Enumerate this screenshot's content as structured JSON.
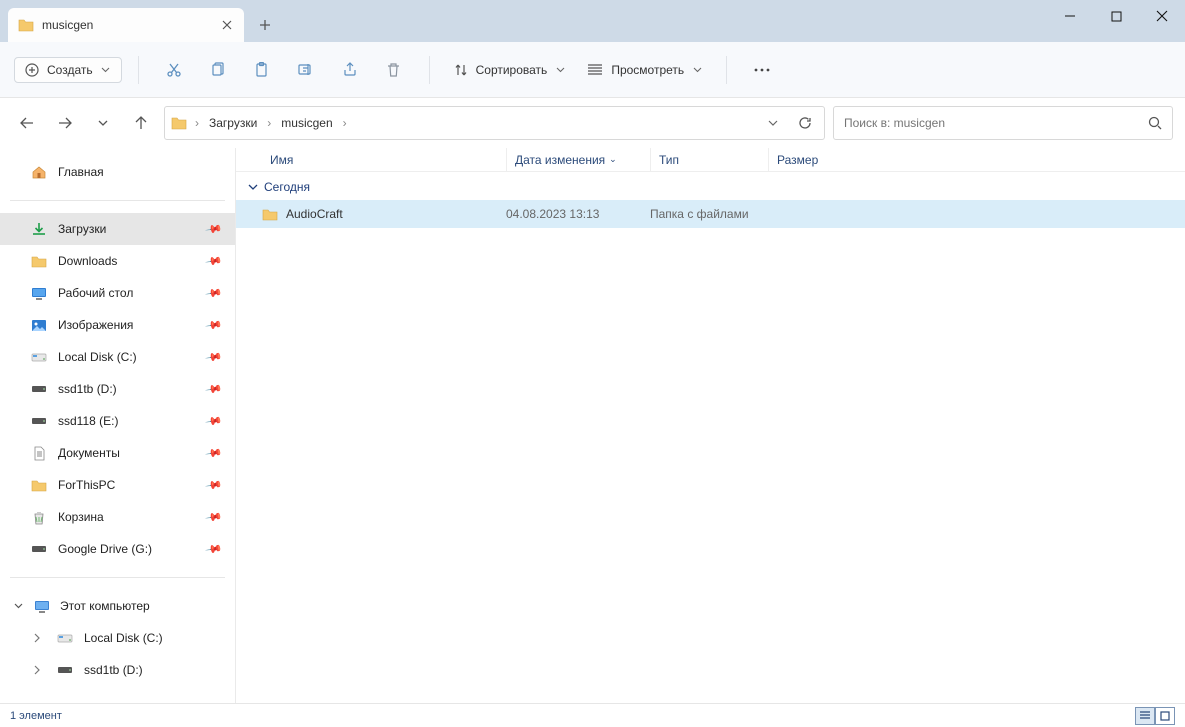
{
  "tab": {
    "title": "musicgen"
  },
  "toolbar": {
    "create": "Создать",
    "sort": "Сортировать",
    "view": "Просмотреть"
  },
  "breadcrumbs": [
    "Загрузки",
    "musicgen"
  ],
  "search": {
    "placeholder": "Поиск в: musicgen"
  },
  "sidebar": {
    "home": "Главная",
    "items": [
      {
        "label": "Загрузки",
        "icon": "download"
      },
      {
        "label": "Downloads",
        "icon": "folder"
      },
      {
        "label": "Рабочий стол",
        "icon": "desktop"
      },
      {
        "label": "Изображения",
        "icon": "pictures"
      },
      {
        "label": "Local Disk (C:)",
        "icon": "drive"
      },
      {
        "label": "ssd1tb (D:)",
        "icon": "drive-dark"
      },
      {
        "label": "ssd118 (E:)",
        "icon": "drive-dark"
      },
      {
        "label": "Документы",
        "icon": "doc"
      },
      {
        "label": "ForThisPC",
        "icon": "folder"
      },
      {
        "label": "Корзина",
        "icon": "recycle"
      },
      {
        "label": "Google Drive (G:)",
        "icon": "drive-dark"
      }
    ],
    "this_pc": "Этот компьютер",
    "drives": [
      {
        "label": "Local Disk (C:)"
      },
      {
        "label": "ssd1tb (D:)"
      }
    ]
  },
  "columns": {
    "name": "Имя",
    "date": "Дата изменения",
    "type": "Тип",
    "size": "Размер"
  },
  "group": "Сегодня",
  "files": [
    {
      "name": "AudioCraft",
      "date": "04.08.2023 13:13",
      "type": "Папка с файлами",
      "size": ""
    }
  ],
  "status": {
    "count": "1 элемент"
  }
}
